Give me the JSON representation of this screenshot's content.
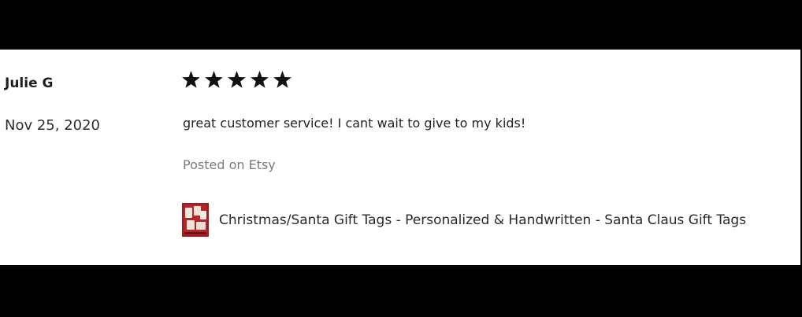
{
  "review": {
    "reviewer_name": "Julie G",
    "date": "Nov 25, 2020",
    "rating": 5,
    "rating_max": 5,
    "text": "great customer service! I cant wait to give to my kids!",
    "source": "Posted on Etsy",
    "product": {
      "title": "Christmas/Santa Gift Tags - Personalized & Handwritten - Santa Claus Gift Tags",
      "thumbnail_icon": "gift-tags-thumbnail"
    }
  },
  "colors": {
    "background_bars": "#000000",
    "card": "#ffffff",
    "star": "#111111",
    "muted_text": "#7a7a7a",
    "thumbnail_red": "#9b1c22"
  }
}
